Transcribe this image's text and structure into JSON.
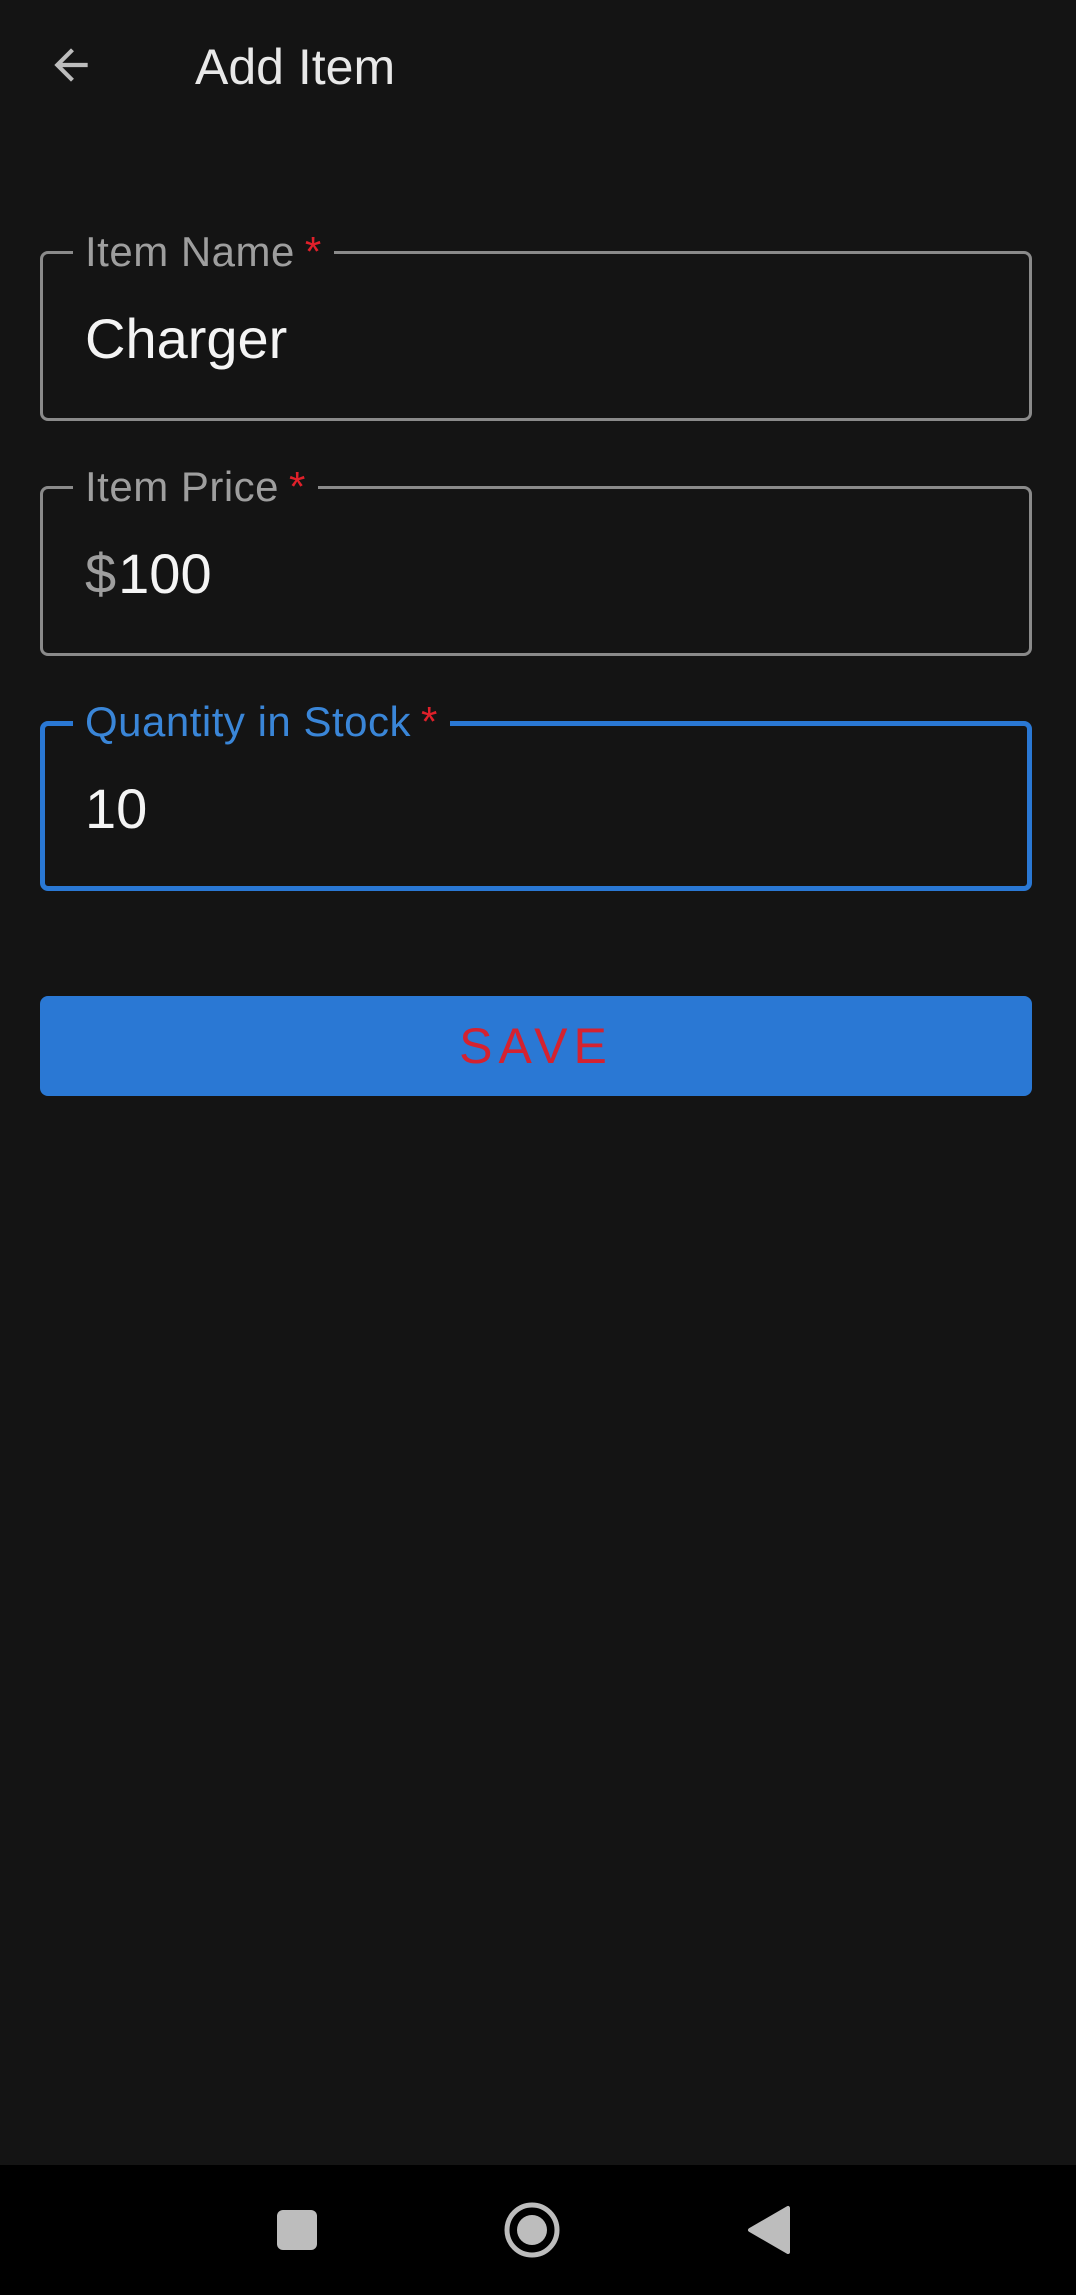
{
  "app_bar": {
    "title": "Add Item",
    "back_icon": "arrow-left-icon"
  },
  "form": {
    "item_name": {
      "label": "Item Name",
      "required_mark": "*",
      "value": "Charger"
    },
    "item_price": {
      "label": "Item Price",
      "required_mark": "*",
      "prefix": "$",
      "value": "100"
    },
    "quantity": {
      "label": "Quantity in Stock",
      "required_mark": "*",
      "value": "10"
    }
  },
  "save_button": {
    "label": "SAVE"
  },
  "nav_bar": {
    "recents_icon": "square-icon",
    "home_icon": "circle-home-icon",
    "back_icon": "triangle-back-icon"
  },
  "colors": {
    "background": "#141414",
    "accent": "#2a78d4",
    "required": "#e0202a",
    "save_text": "#d42230"
  }
}
